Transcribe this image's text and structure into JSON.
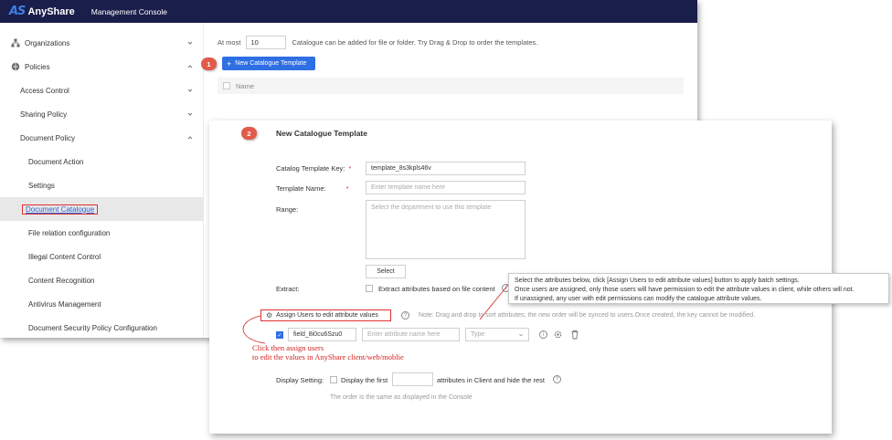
{
  "app": {
    "brand_mark": "AS",
    "brand_name": "AnyShare",
    "console_title": "Management Console"
  },
  "sidebar": {
    "items": [
      {
        "label": "Organizations",
        "icon": "organizations-icon",
        "chevron": "down"
      },
      {
        "label": "Policies",
        "icon": "shield-icon",
        "chevron": "up"
      },
      {
        "label": "Access Control",
        "chevron": "down"
      },
      {
        "label": "Sharing Policy",
        "chevron": "down"
      },
      {
        "label": "Document Policy",
        "chevron": "up"
      },
      {
        "label": "Document Action"
      },
      {
        "label": "Settings"
      },
      {
        "label": "Document Catalogue",
        "selected": true
      },
      {
        "label": "File relation configuration"
      },
      {
        "label": "Illegal Content Control"
      },
      {
        "label": "Content Recognition"
      },
      {
        "label": "Antivirus Management"
      },
      {
        "label": "Document Security Policy Configuration"
      }
    ]
  },
  "main": {
    "limit_prefix": "At most",
    "limit_value": "10",
    "limit_suffix": "Catalogue can be added for file or folder. Try Drag & Drop to order the templates.",
    "new_button": "New Catalogue Template",
    "column_name": "Name"
  },
  "badges": {
    "step1": "1",
    "step2": "2"
  },
  "dialog": {
    "title": "New Catalogue Template",
    "key_label": "Catalog Template Key:",
    "key_value": "template_8s3kpls46v",
    "name_label": "Template Name:",
    "name_placeholder": "Enter template name here",
    "range_label": "Range:",
    "range_placeholder": "Select the department to use this template",
    "select_button": "Select",
    "extract_label": "Extract:",
    "extract_option": "Extract attributes based on file content",
    "assign_button": "Assign Users to edit attribute values",
    "note": "Note: Drag and drop to sort attributes; the new order will be synced to users.Once created, the key cannot be modified.",
    "field_key": "field_8i0cu6Szu0",
    "attr_placeholder": "Enter attribute name here",
    "type_placeholder": "Type",
    "display_label": "Display Setting:",
    "display_prefix": "Display the first",
    "display_suffix": "attributes in Client and hide the rest",
    "order_note": "The order is the same as displayed in the Console"
  },
  "tooltip": {
    "line1": "Select the attributes below, click [Assign Users to edit attribute values] button to apply batch settings.",
    "line2": "Once users are assigned, only those users will have permission to edit the attribute values in client, while others will not.",
    "line3": "If unassigned, any user with edit permissions can modify the catalogue attribute values."
  },
  "annotation": {
    "line1": "Click then assign users",
    "line2": "to edit the values in AnyShare client/web/moblie"
  },
  "colors": {
    "topbar": "#1a1e4a",
    "primary": "#2f6fe4",
    "highlight": "#e03030",
    "badge": "#e25a4a"
  }
}
